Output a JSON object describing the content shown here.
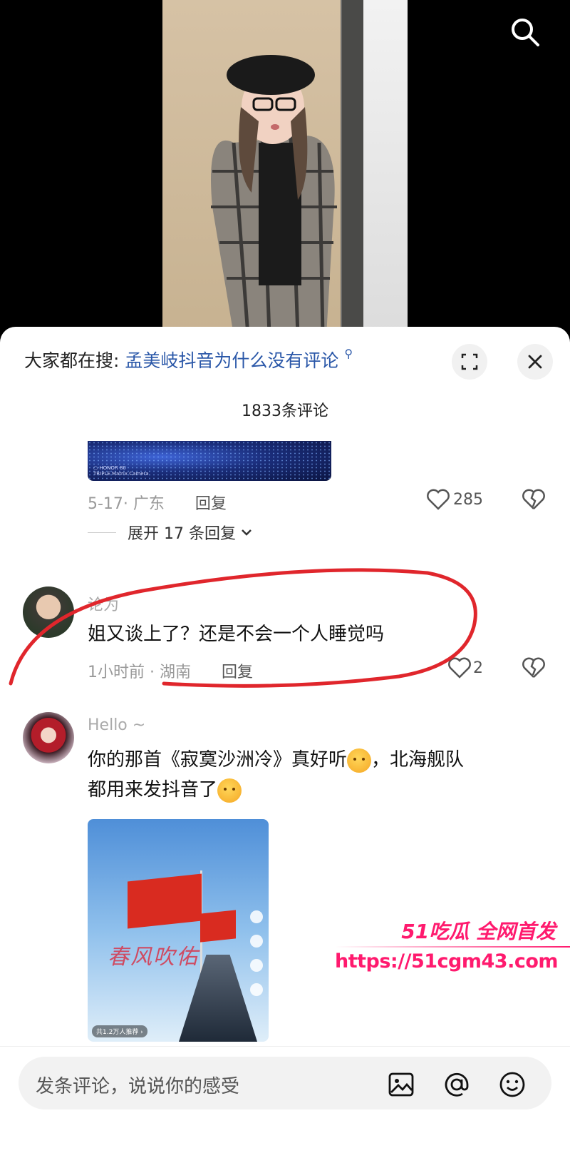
{
  "video": {},
  "sheet": {
    "search_prefix": "大家都在搜:",
    "search_term": "孟美岐抖音为什么没有评论",
    "comment_count": "1833条评论"
  },
  "comments": [
    {
      "meta": "5-17· 广东",
      "reply": "回复",
      "likes": "285",
      "expand": "展开 17 条回复"
    },
    {
      "username": "论为",
      "text": "姐又谈上了？还是不会一个人睡觉吗",
      "meta": "1小时前 · 湖南",
      "reply": "回复",
      "likes": "2"
    },
    {
      "username": "Hello ~",
      "text_part1": "你的那首《寂寞沙洲冷》真好听",
      "text_part2": "，北海舰队",
      "text_part3": "都用来发抖音了",
      "image_slogan": "春风吹佑",
      "image_badge": "共1.2万人推荐 ›"
    }
  ],
  "thumb_caption": "○ HONOR 80\nTRIPLE Matrix Camera",
  "watermark": {
    "top": "51吃瓜 全网首发",
    "url": "https://51cgm43.com"
  },
  "input": {
    "placeholder": "发条评论，说说你的感受"
  },
  "colors": {
    "link": "#2a57a8",
    "annotation_red": "#e0262c",
    "watermark_pink": "#ff1a6e"
  }
}
